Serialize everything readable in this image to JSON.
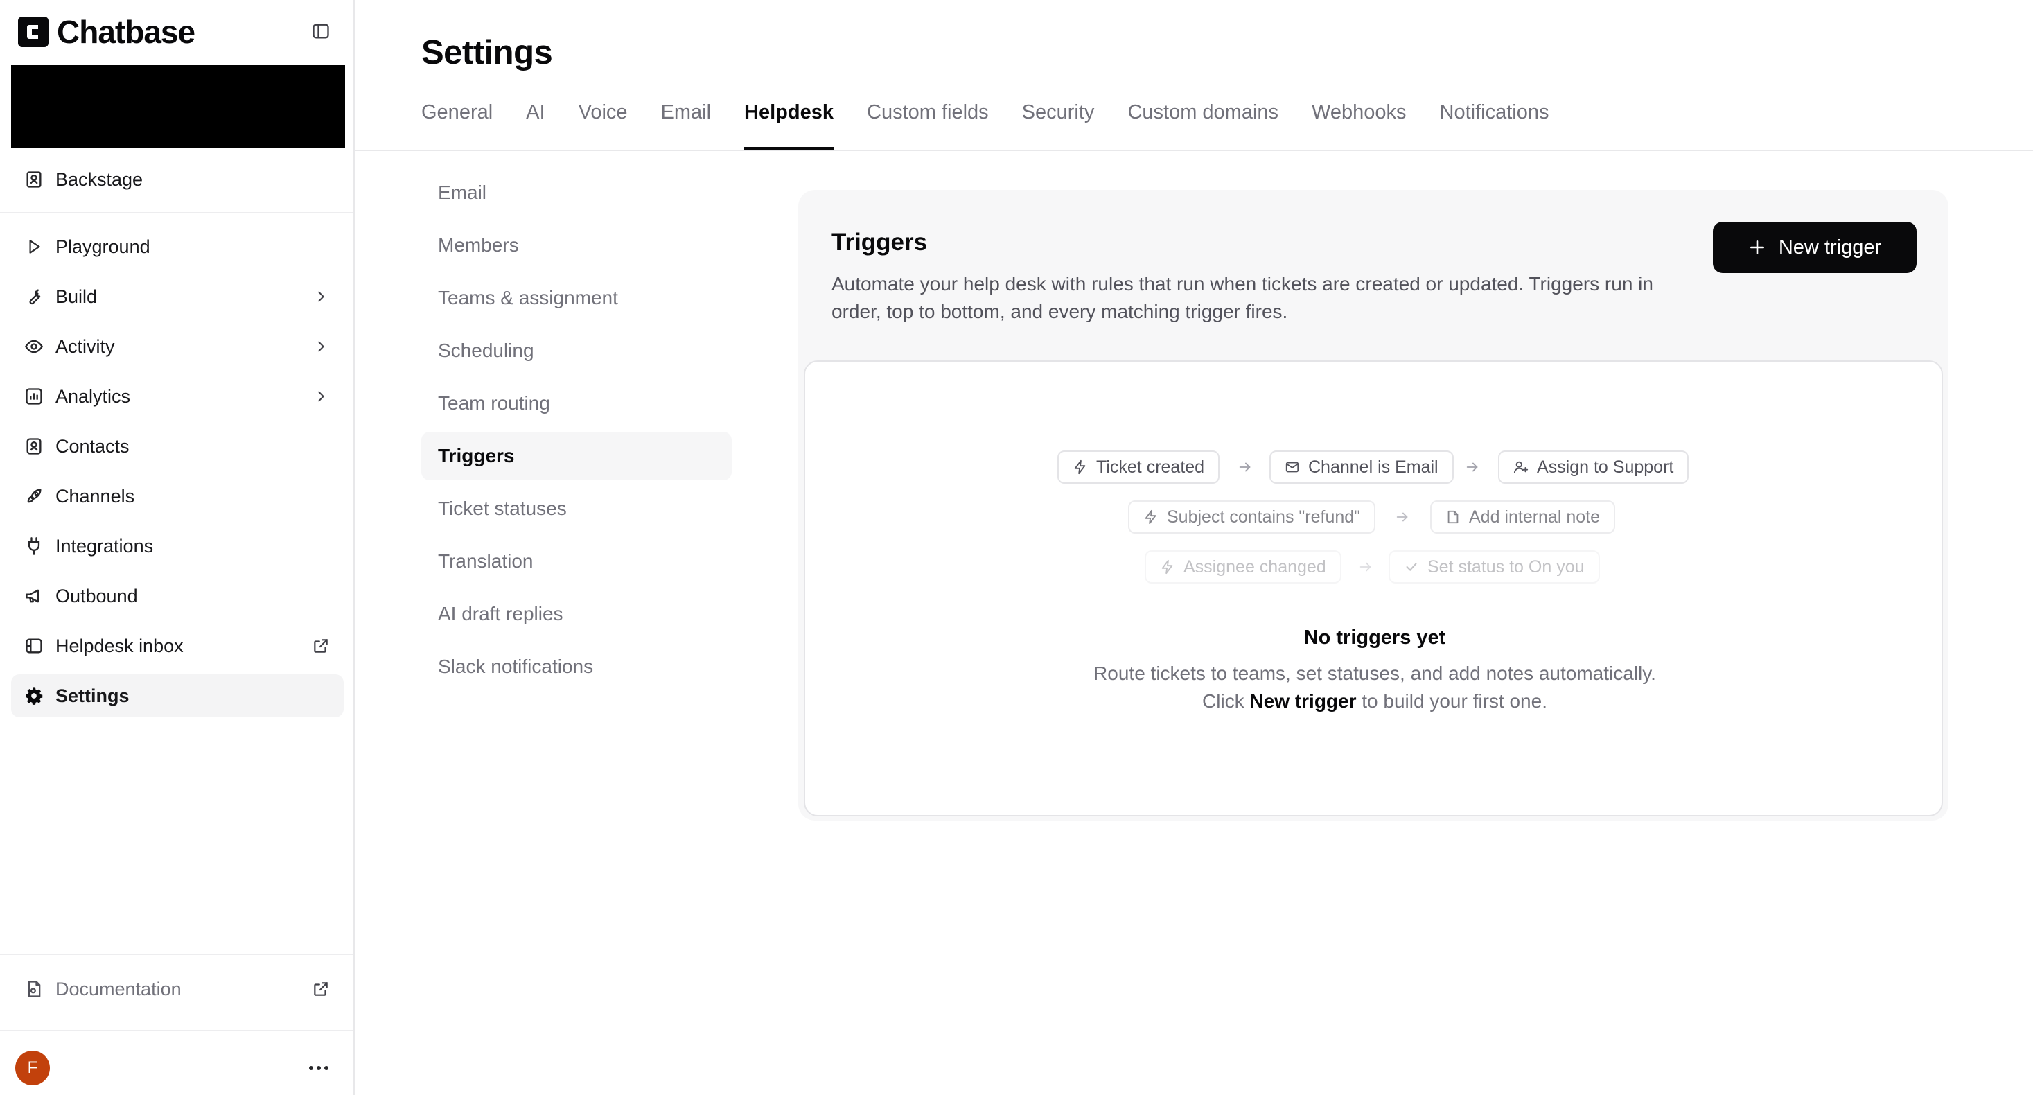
{
  "app": {
    "name": "Chatbase"
  },
  "sidebar": {
    "backstage": "Backstage",
    "items": [
      {
        "label": "Playground",
        "icon": "play-icon"
      },
      {
        "label": "Build",
        "icon": "wrench-icon",
        "chevron": true
      },
      {
        "label": "Activity",
        "icon": "eye-icon",
        "chevron": true
      },
      {
        "label": "Analytics",
        "icon": "chart-icon",
        "chevron": true
      },
      {
        "label": "Contacts",
        "icon": "contacts-icon"
      },
      {
        "label": "Channels",
        "icon": "rocket-icon"
      },
      {
        "label": "Integrations",
        "icon": "plug-icon"
      },
      {
        "label": "Outbound",
        "icon": "megaphone-icon"
      },
      {
        "label": "Helpdesk inbox",
        "icon": "inbox-icon",
        "external": true
      },
      {
        "label": "Settings",
        "icon": "gear-icon",
        "active": true
      }
    ],
    "documentation": "Documentation",
    "user_initial": "F",
    "more_label": "..."
  },
  "header": {
    "title": "Settings",
    "tabs": [
      "General",
      "AI",
      "Voice",
      "Email",
      "Helpdesk",
      "Custom fields",
      "Security",
      "Custom domains",
      "Webhooks",
      "Notifications"
    ],
    "active_tab": "Helpdesk"
  },
  "subnav": {
    "items": [
      "Email",
      "Members",
      "Teams & assignment",
      "Scheduling",
      "Team routing",
      "Triggers",
      "Ticket statuses",
      "Translation",
      "AI draft replies",
      "Slack notifications"
    ],
    "active": "Triggers"
  },
  "triggers": {
    "title": "Triggers",
    "description": "Automate your help desk with rules that run when tickets are created or updated. Triggers run in order, top to bottom, and every matching trigger fires.",
    "new_button": "New trigger",
    "examples": [
      {
        "when": "Ticket created",
        "if": "Channel is Email",
        "then": "Assign to Support"
      },
      {
        "when": "Subject contains \"refund\"",
        "then": "Add internal note"
      },
      {
        "when": "Assignee changed",
        "then": "Set status to On you"
      }
    ],
    "empty_title": "No triggers yet",
    "empty_text_before": "Route tickets to teams, set statuses, and add notes automatically. Click ",
    "empty_text_link": "New trigger",
    "empty_text_after": " to build your first one."
  }
}
